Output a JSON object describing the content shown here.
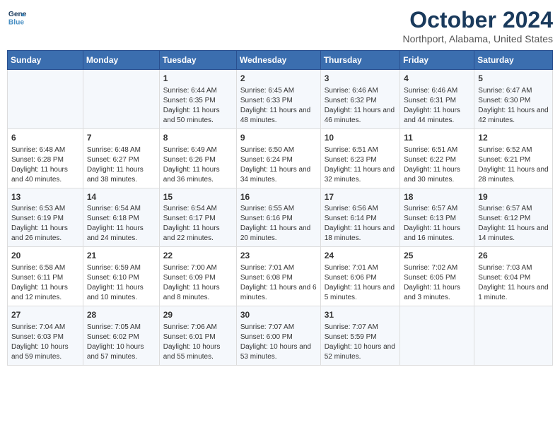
{
  "header": {
    "logo_line1": "General",
    "logo_line2": "Blue",
    "month": "October 2024",
    "location": "Northport, Alabama, United States"
  },
  "weekdays": [
    "Sunday",
    "Monday",
    "Tuesday",
    "Wednesday",
    "Thursday",
    "Friday",
    "Saturday"
  ],
  "weeks": [
    [
      {
        "day": "",
        "content": ""
      },
      {
        "day": "",
        "content": ""
      },
      {
        "day": "1",
        "content": "Sunrise: 6:44 AM\nSunset: 6:35 PM\nDaylight: 11 hours and 50 minutes."
      },
      {
        "day": "2",
        "content": "Sunrise: 6:45 AM\nSunset: 6:33 PM\nDaylight: 11 hours and 48 minutes."
      },
      {
        "day": "3",
        "content": "Sunrise: 6:46 AM\nSunset: 6:32 PM\nDaylight: 11 hours and 46 minutes."
      },
      {
        "day": "4",
        "content": "Sunrise: 6:46 AM\nSunset: 6:31 PM\nDaylight: 11 hours and 44 minutes."
      },
      {
        "day": "5",
        "content": "Sunrise: 6:47 AM\nSunset: 6:30 PM\nDaylight: 11 hours and 42 minutes."
      }
    ],
    [
      {
        "day": "6",
        "content": "Sunrise: 6:48 AM\nSunset: 6:28 PM\nDaylight: 11 hours and 40 minutes."
      },
      {
        "day": "7",
        "content": "Sunrise: 6:48 AM\nSunset: 6:27 PM\nDaylight: 11 hours and 38 minutes."
      },
      {
        "day": "8",
        "content": "Sunrise: 6:49 AM\nSunset: 6:26 PM\nDaylight: 11 hours and 36 minutes."
      },
      {
        "day": "9",
        "content": "Sunrise: 6:50 AM\nSunset: 6:24 PM\nDaylight: 11 hours and 34 minutes."
      },
      {
        "day": "10",
        "content": "Sunrise: 6:51 AM\nSunset: 6:23 PM\nDaylight: 11 hours and 32 minutes."
      },
      {
        "day": "11",
        "content": "Sunrise: 6:51 AM\nSunset: 6:22 PM\nDaylight: 11 hours and 30 minutes."
      },
      {
        "day": "12",
        "content": "Sunrise: 6:52 AM\nSunset: 6:21 PM\nDaylight: 11 hours and 28 minutes."
      }
    ],
    [
      {
        "day": "13",
        "content": "Sunrise: 6:53 AM\nSunset: 6:19 PM\nDaylight: 11 hours and 26 minutes."
      },
      {
        "day": "14",
        "content": "Sunrise: 6:54 AM\nSunset: 6:18 PM\nDaylight: 11 hours and 24 minutes."
      },
      {
        "day": "15",
        "content": "Sunrise: 6:54 AM\nSunset: 6:17 PM\nDaylight: 11 hours and 22 minutes."
      },
      {
        "day": "16",
        "content": "Sunrise: 6:55 AM\nSunset: 6:16 PM\nDaylight: 11 hours and 20 minutes."
      },
      {
        "day": "17",
        "content": "Sunrise: 6:56 AM\nSunset: 6:14 PM\nDaylight: 11 hours and 18 minutes."
      },
      {
        "day": "18",
        "content": "Sunrise: 6:57 AM\nSunset: 6:13 PM\nDaylight: 11 hours and 16 minutes."
      },
      {
        "day": "19",
        "content": "Sunrise: 6:57 AM\nSunset: 6:12 PM\nDaylight: 11 hours and 14 minutes."
      }
    ],
    [
      {
        "day": "20",
        "content": "Sunrise: 6:58 AM\nSunset: 6:11 PM\nDaylight: 11 hours and 12 minutes."
      },
      {
        "day": "21",
        "content": "Sunrise: 6:59 AM\nSunset: 6:10 PM\nDaylight: 11 hours and 10 minutes."
      },
      {
        "day": "22",
        "content": "Sunrise: 7:00 AM\nSunset: 6:09 PM\nDaylight: 11 hours and 8 minutes."
      },
      {
        "day": "23",
        "content": "Sunrise: 7:01 AM\nSunset: 6:08 PM\nDaylight: 11 hours and 6 minutes."
      },
      {
        "day": "24",
        "content": "Sunrise: 7:01 AM\nSunset: 6:06 PM\nDaylight: 11 hours and 5 minutes."
      },
      {
        "day": "25",
        "content": "Sunrise: 7:02 AM\nSunset: 6:05 PM\nDaylight: 11 hours and 3 minutes."
      },
      {
        "day": "26",
        "content": "Sunrise: 7:03 AM\nSunset: 6:04 PM\nDaylight: 11 hours and 1 minute."
      }
    ],
    [
      {
        "day": "27",
        "content": "Sunrise: 7:04 AM\nSunset: 6:03 PM\nDaylight: 10 hours and 59 minutes."
      },
      {
        "day": "28",
        "content": "Sunrise: 7:05 AM\nSunset: 6:02 PM\nDaylight: 10 hours and 57 minutes."
      },
      {
        "day": "29",
        "content": "Sunrise: 7:06 AM\nSunset: 6:01 PM\nDaylight: 10 hours and 55 minutes."
      },
      {
        "day": "30",
        "content": "Sunrise: 7:07 AM\nSunset: 6:00 PM\nDaylight: 10 hours and 53 minutes."
      },
      {
        "day": "31",
        "content": "Sunrise: 7:07 AM\nSunset: 5:59 PM\nDaylight: 10 hours and 52 minutes."
      },
      {
        "day": "",
        "content": ""
      },
      {
        "day": "",
        "content": ""
      }
    ]
  ]
}
